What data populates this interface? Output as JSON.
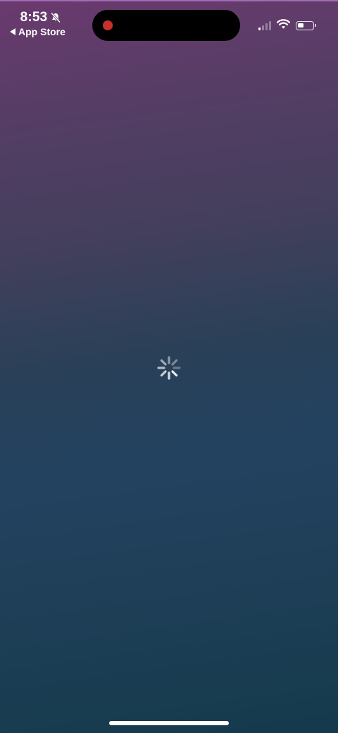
{
  "status_bar": {
    "time": "8:53",
    "back_label": "App Store",
    "icons": [
      "bell-slash-icon",
      "cellular-signal-icon",
      "wifi-icon",
      "battery-icon"
    ],
    "battery_level_fraction": 0.4,
    "signal_bars_active": 1,
    "signal_bars_total": 4,
    "recording_indicator_color": "#c9302c"
  },
  "main": {
    "state": "loading",
    "spinner_icon": "activity-spinner-icon"
  },
  "colors": {
    "gradient_top": "#6a3a6e",
    "gradient_mid": "#2a4058",
    "gradient_bottom": "#153a4c"
  }
}
